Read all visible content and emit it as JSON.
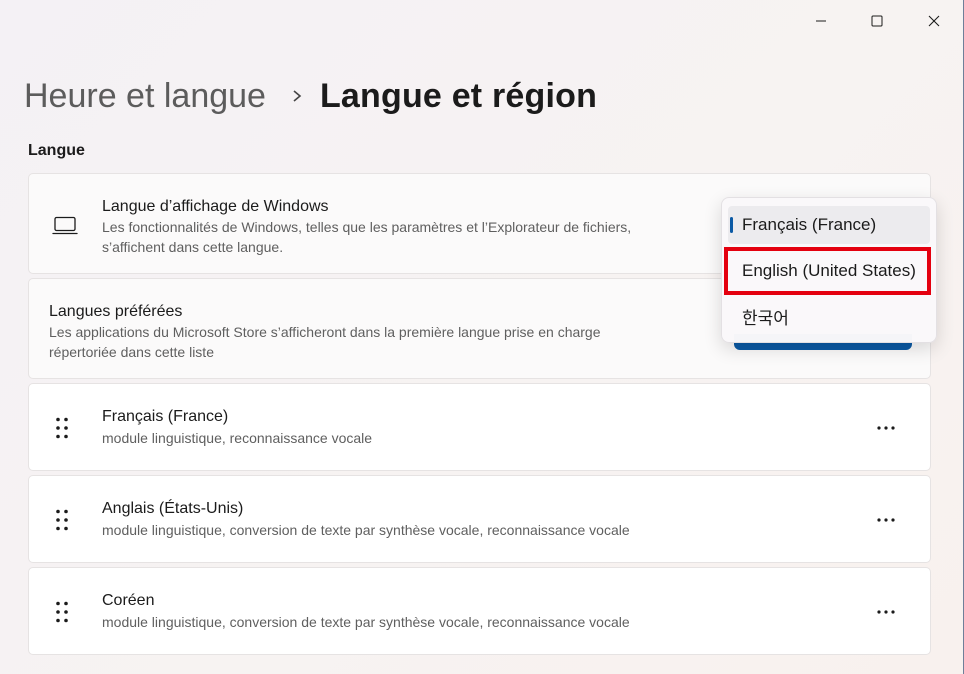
{
  "window": {
    "controls": [
      "minimize-icon",
      "maximize-icon",
      "close-icon"
    ]
  },
  "breadcrumb": {
    "parent": "Heure et langue",
    "current": "Langue et région"
  },
  "section": {
    "title": "Langue"
  },
  "display_language": {
    "title": "Langue d’affichage de Windows",
    "desc_line1": "Les fonctionnalités de Windows, telles que les paramètres et l’Explorateur de fichiers,",
    "desc_line2": "s’affichent dans cette langue."
  },
  "preferred_languages": {
    "title": "Langues préférées",
    "desc_line1": "Les applications du Microsoft Store s’afficheront dans la première langue prise en charge",
    "desc_line2": "répertoriée dans cette liste"
  },
  "languages": [
    {
      "name": "Français (France)",
      "features": "module linguistique, reconnaissance vocale"
    },
    {
      "name": "Anglais (États-Unis)",
      "features": "module linguistique, conversion de texte par synthèse vocale, reconnaissance vocale"
    },
    {
      "name": "Coréen",
      "features": "module linguistique, conversion de texte par synthèse vocale, reconnaissance vocale"
    }
  ],
  "dropdown": {
    "options": [
      "Français (France)",
      "English (United States)",
      "한국어"
    ],
    "selected": "Français (France)",
    "highlighted": "English (United States)"
  },
  "colors": {
    "accent": "#0b5aa5",
    "highlight": "#e4000f"
  }
}
